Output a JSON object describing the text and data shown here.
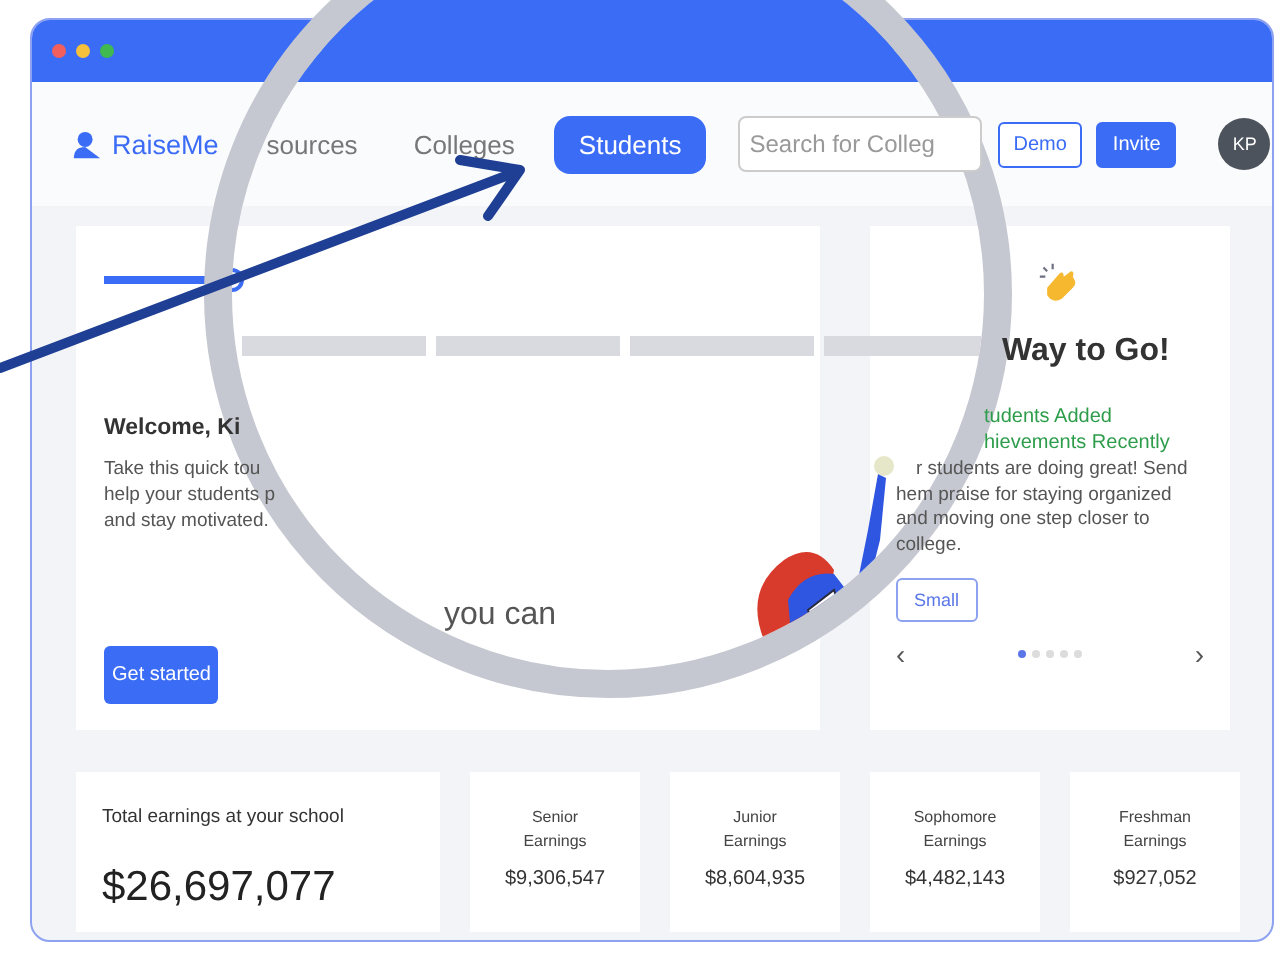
{
  "window": {
    "controls": [
      {
        "color": "#f25f5c"
      },
      {
        "color": "#f5c13b"
      },
      {
        "color": "#3fb950"
      }
    ]
  },
  "nav": {
    "logo": "RaiseMe",
    "items": [
      {
        "label": "sources",
        "selected": false
      },
      {
        "label": "Colleges",
        "selected": false
      },
      {
        "label": "Students",
        "selected": true
      }
    ],
    "search": {
      "placeholder": "Search for Colleg"
    },
    "buttons": [
      {
        "label": "Demo",
        "kind": "outline"
      },
      {
        "label": "Invite",
        "kind": "solid"
      }
    ],
    "avatar": "KP"
  },
  "welcome": {
    "title": "Welcome, Ki",
    "lines": [
      "Take this quick tou",
      "help your students p",
      "and stay motivated."
    ],
    "lens_text": "you can",
    "button": "Get started"
  },
  "promo": {
    "title": "Way to Go!",
    "highlight": [
      "tudents Added",
      "hievements Recently"
    ],
    "lines": [
      "r students are doing great! Send",
      "hem praise for staying organized",
      "and moving one step closer to",
      "college."
    ],
    "button": "Small",
    "prev": "‹",
    "next": "›",
    "dots": [
      {
        "selected": true
      },
      {
        "selected": false
      },
      {
        "selected": false
      },
      {
        "selected": false
      },
      {
        "selected": false
      }
    ]
  },
  "earnings": {
    "total_label": "Total earnings at your school",
    "total": "$26,697,077",
    "classes": [
      {
        "label": "Senior Earnings",
        "value": "$9,306,547"
      },
      {
        "label": "Junior Earnings",
        "value": "$8,604,935"
      },
      {
        "label": "Sophomore Earnings",
        "value": "$4,482,143"
      },
      {
        "label": "Freshman Earnings",
        "value": "$927,052"
      }
    ]
  }
}
